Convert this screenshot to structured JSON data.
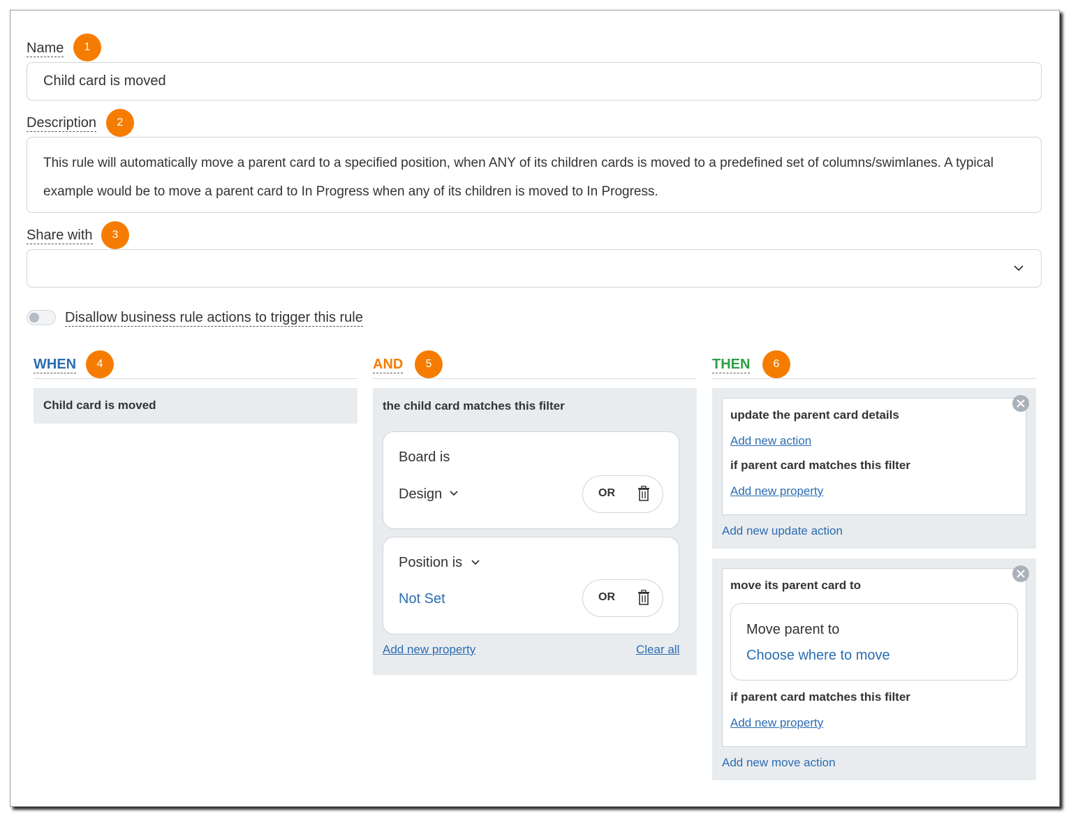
{
  "form": {
    "name_label": "Name",
    "name_badge": "1",
    "name_value": "Child card is moved",
    "description_label": "Description",
    "description_badge": "2",
    "description_value": "This rule will automatically move a parent card to a specified position, when ANY of its children cards is moved to a predefined set of columns/swimlanes. A typical example would be to move a parent card to In Progress when any of its children is moved to In Progress.",
    "share_label": "Share with",
    "share_badge": "3",
    "share_value": "",
    "toggle_label": "Disallow business rule actions to trigger this rule",
    "toggle_on": false
  },
  "when": {
    "heading": "WHEN",
    "badge": "4",
    "color": "#2b6cb0",
    "trigger": "Child card is moved"
  },
  "and": {
    "heading": "AND",
    "badge": "5",
    "color": "#f57c00",
    "filter_title": "the child card matches this filter",
    "cond1": {
      "label": "Board is",
      "value": "Design",
      "or_label": "OR"
    },
    "cond2": {
      "label": "Position is",
      "value": "Not Set",
      "or_label": "OR"
    },
    "add_property": "Add new property",
    "clear_all": "Clear all"
  },
  "then": {
    "heading": "THEN",
    "badge": "6",
    "color": "#2e9e44",
    "update": {
      "title": "update the parent card details",
      "add_action": "Add new action",
      "filter_title": "if parent card matches this filter",
      "add_property": "Add new property",
      "add_update_action": "Add new update action"
    },
    "move": {
      "title": "move its parent card to",
      "move_label": "Move parent to",
      "move_value": "Choose where to move",
      "filter_title": "if parent card matches this filter",
      "add_property": "Add new property",
      "add_move_action": "Add new move action"
    }
  },
  "colors": {
    "badge": "#f57c00",
    "link": "#2b6cb0",
    "panel": "#e9ecef"
  }
}
